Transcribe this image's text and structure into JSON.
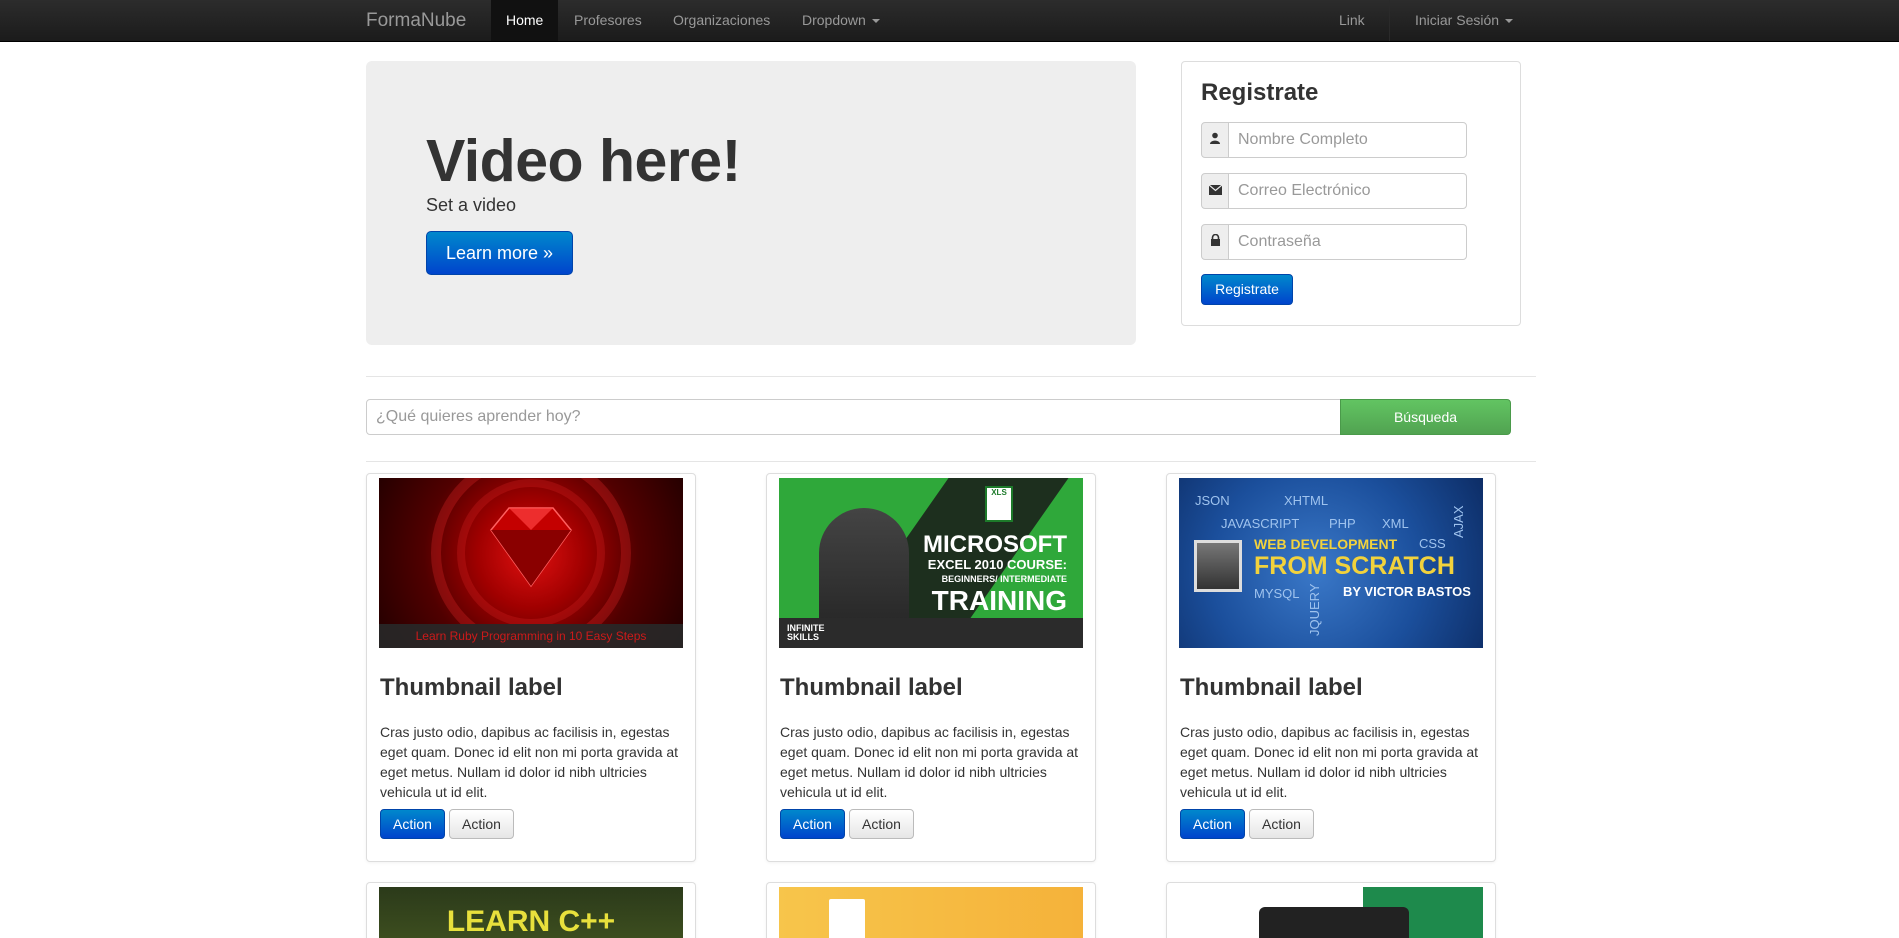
{
  "navbar": {
    "brand": "FormaNube",
    "items": [
      {
        "label": "Home",
        "active": true
      },
      {
        "label": "Profesores"
      },
      {
        "label": "Organizaciones"
      },
      {
        "label": "Dropdown"
      }
    ],
    "right_items": [
      {
        "label": "Link"
      },
      {
        "label": "Iniciar Sesión"
      }
    ]
  },
  "hero": {
    "title": "Video here!",
    "subtitle": "Set a video",
    "button": "Learn more »"
  },
  "register": {
    "title": "Registrate",
    "name_placeholder": "Nombre Completo",
    "email_placeholder": "Correo Electrónico",
    "password_placeholder": "Contraseña",
    "button": "Registrate"
  },
  "search": {
    "placeholder": "¿Qué quieres aprender hoy?",
    "button": "Búsqueda"
  },
  "thumbnails": [
    {
      "label": "Thumbnail label",
      "text": "Cras justo odio, dapibus ac facilisis in, egestas eget quam. Donec id elit non mi porta gravida at eget metus. Nullam id dolor id nibh ultricies vehicula ut id elit.",
      "primary_action": "Action",
      "secondary_action": "Action",
      "image_caption": "Learn Ruby Programming in 10 Easy Steps"
    },
    {
      "label": "Thumbnail label",
      "text": "Cras justo odio, dapibus ac facilisis in, egestas eget quam. Donec id elit non mi porta gravida at eget metus. Nullam id dolor id nibh ultricies vehicula ut id elit.",
      "primary_action": "Action",
      "secondary_action": "Action",
      "image_lines": [
        "MICROSOFT",
        "EXCEL 2010 COURSE:",
        "BEGINNERS/ INTERMEDIATE",
        "TRAINING",
        "INFINITE",
        "SKILLS",
        "XLS"
      ]
    },
    {
      "label": "Thumbnail label",
      "text": "Cras justo odio, dapibus ac facilisis in, egestas eget quam. Donec id elit non mi porta gravida at eget metus. Nullam id dolor id nibh ultricies vehicula ut id elit.",
      "primary_action": "Action",
      "secondary_action": "Action",
      "image_lines": [
        "WEB DEVELOPMENT",
        "FROM SCRATCH",
        "BY VICTOR BASTOS",
        "JSON",
        "XHTML",
        "JAVASCRIPT",
        "PHP",
        "XML",
        "CSS",
        "AJAX",
        "MYSQL",
        "JQUERY"
      ]
    }
  ],
  "partial_thumbnails": [
    {
      "image_text": "LEARN C++"
    },
    {
      "image_text": ""
    },
    {
      "image_text": ""
    }
  ],
  "icons": {
    "user": "user-icon",
    "envelope": "envelope-icon",
    "lock": "lock-icon"
  },
  "colors": {
    "primary": "#0055cc",
    "success": "#5bb75b",
    "navbar": "#1b1b1b"
  }
}
